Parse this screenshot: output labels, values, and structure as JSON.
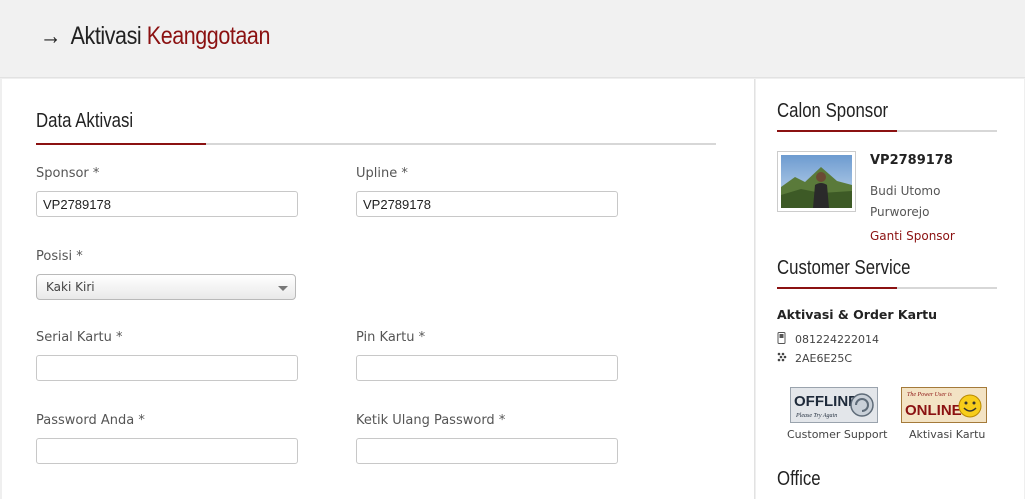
{
  "header": {
    "arrow": "→",
    "title_main": "Aktivasi",
    "title_accent": "Keanggotaan"
  },
  "form": {
    "title": "Data Aktivasi",
    "sponsor": {
      "label": "Sponsor *",
      "value": "VP2789178"
    },
    "upline": {
      "label": "Upline *",
      "value": "VP2789178"
    },
    "posisi": {
      "label": "Posisi *",
      "selected": "Kaki Kiri"
    },
    "serial_kartu": {
      "label": "Serial Kartu *",
      "value": ""
    },
    "pin_kartu": {
      "label": "Pin Kartu *",
      "value": ""
    },
    "password": {
      "label": "Password Anda *",
      "value": ""
    },
    "password_confirm": {
      "label": "Ketik Ulang Password *",
      "value": ""
    }
  },
  "sidebar": {
    "sponsor_section": {
      "title": "Calon Sponsor",
      "id": "VP2789178",
      "name": "Budi Utomo",
      "city": "Purworejo",
      "change_link": "Ganti Sponsor"
    },
    "customer_service": {
      "title": "Customer Service",
      "heading": "Aktivasi & Order Kartu",
      "phone": "081224222014",
      "bbm_pin": "2AE6E25C",
      "badges": [
        {
          "status_text": "OFFLINE",
          "sub_text": "Please Try Again",
          "label": "Customer Support"
        },
        {
          "status_text": "ONLINE",
          "sub_text": "The Power User is",
          "label": "Aktivasi Kartu"
        }
      ]
    },
    "office_title": "Office"
  },
  "colors": {
    "accent": "#8b1111",
    "rule": "#d7d7d7",
    "background": "#efefef"
  }
}
